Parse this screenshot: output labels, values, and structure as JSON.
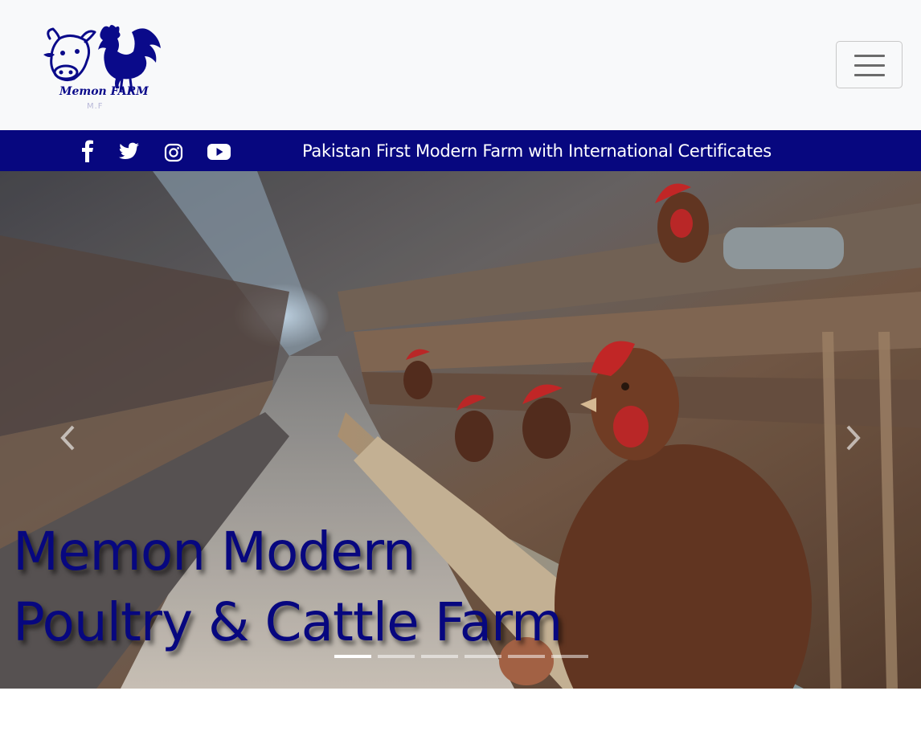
{
  "header": {
    "logo": {
      "brand_text": "Memon FARM",
      "sub_text": "M.F"
    },
    "menu_toggle_icon": "hamburger-icon"
  },
  "topbar": {
    "social_icons": [
      "facebook-icon",
      "twitter-icon",
      "instagram-icon",
      "youtube-icon"
    ],
    "tagline": "Pakistan First Modern Farm with International Certificates"
  },
  "carousel": {
    "caption_line1": "Memon Modern",
    "caption_line2": "Poultry & Cattle Farm",
    "prev_icon": "chevron-left-icon",
    "next_icon": "chevron-right-icon",
    "slide_count": 6,
    "active_slide": 1
  },
  "colors": {
    "brand_blue": "#07077f",
    "header_bg": "#f8f9fa"
  }
}
